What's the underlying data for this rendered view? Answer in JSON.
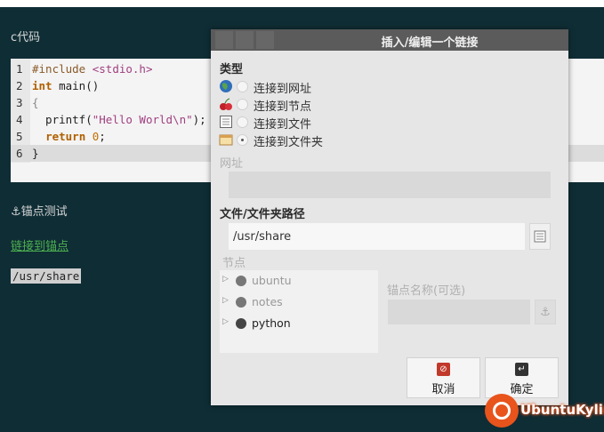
{
  "editor": {
    "heading": "c代码",
    "code_lines": [
      {
        "n": "1",
        "html": "<span class=\"inc\">#include</span> <span class=\"str\">&lt;stdio.h&gt;</span>"
      },
      {
        "n": "2",
        "html": "<span class=\"kw\">int</span> main()"
      },
      {
        "n": "3",
        "html": "<span style=\"color:#888\">{</span>"
      },
      {
        "n": "4",
        "html": "  printf(<span class=\"str\">\"Hello World\\n\"</span>);"
      },
      {
        "n": "5",
        "html": "  <span class=\"kw\">return</span> <span class=\"num\">0</span>;"
      },
      {
        "n": "6",
        "html": "}"
      }
    ],
    "anchor_icon": "⚓",
    "anchor_text": "锚点测试",
    "link_text": "链接到锚点",
    "path_text": "/usr/share"
  },
  "dialog": {
    "title": "插入/编辑一个链接",
    "type_section": "类型",
    "options": [
      {
        "label": "连接到网址",
        "icon": "globe-icon",
        "selected": false
      },
      {
        "label": "连接到节点",
        "icon": "cherry-icon",
        "selected": false
      },
      {
        "label": "连接到文件",
        "icon": "file-icon",
        "selected": false
      },
      {
        "label": "连接到文件夹",
        "icon": "folder-icon",
        "selected": true
      }
    ],
    "url_section": "网址",
    "url_value": "",
    "path_section": "文件/文件夹路径",
    "path_value": "/usr/share",
    "nodes_section": "节点",
    "nodes": [
      {
        "label": "ubuntu",
        "dim": true
      },
      {
        "label": "notes",
        "dim": true
      },
      {
        "label": "python",
        "dim": false
      }
    ],
    "anchor_section": "锚点名称(可选)",
    "anchor_value": "",
    "cancel_label": "取消",
    "ok_label": "确定",
    "colors": {
      "cancel": "#c0392b",
      "ok": "#333333"
    }
  },
  "watermark": "UbuntuKylin"
}
